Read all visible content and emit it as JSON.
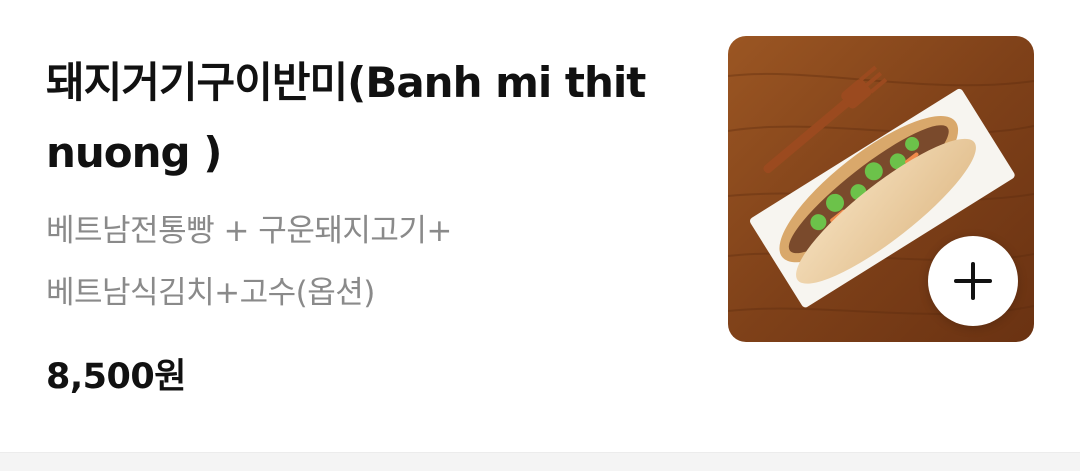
{
  "menu_item": {
    "name": "돼지거기구이반미(Banh mi thit nuong )",
    "description_line1": "베트남전통빵 + 구운돼지고기+",
    "description_line2": "베트남식김치+고수(옵션)",
    "price": "8,500원",
    "image_icon": "banh-mi-photo",
    "add_icon": "plus-icon"
  },
  "colors": {
    "title": "#111111",
    "description": "#8a8a8a",
    "wood_table": "#8a4a1e",
    "plate": "#f7f5f0"
  }
}
